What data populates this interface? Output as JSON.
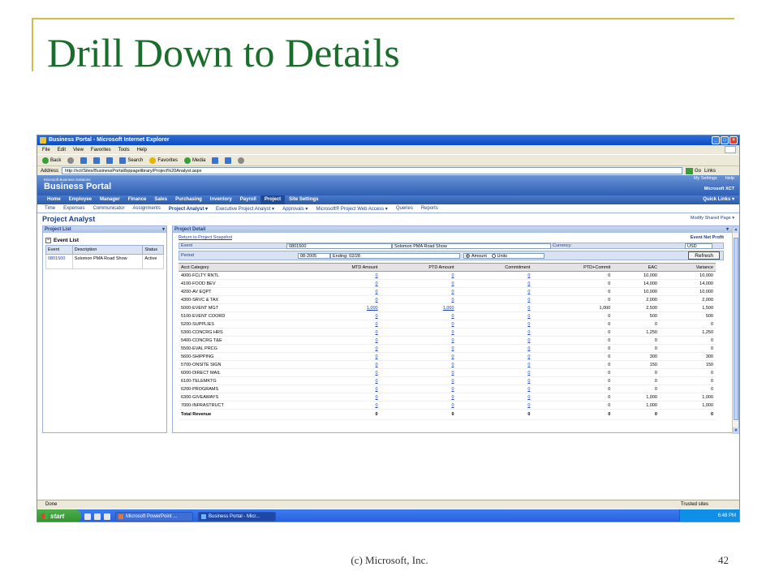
{
  "slide": {
    "title": "Drill Down to Details",
    "footer": "(c) Microsoft, Inc.",
    "page_number": "42"
  },
  "browser": {
    "title": "Business Portal - Microsoft Internet Explorer",
    "menu": [
      "File",
      "Edit",
      "View",
      "Favorites",
      "Tools",
      "Help"
    ],
    "toolbar": {
      "back": "Back",
      "search": "Search",
      "favorites": "Favorites",
      "media": "Media"
    },
    "address_label": "Address",
    "address_url": "http://xct/Sites/BusinessPortal/bppagelibrary/Project%20Analyst.aspx",
    "go": "Go",
    "links": "Links"
  },
  "portal": {
    "brand_sub": "Microsoft Business Solutions",
    "brand": "Business Portal",
    "top_links": [
      "My Settings",
      "Help"
    ],
    "company": "Microsoft XCT",
    "nav": [
      "Home",
      "Employee",
      "Manager",
      "Finance",
      "Sales",
      "Purchasing",
      "Inventory",
      "Payroll",
      "Project",
      "Site Settings"
    ],
    "active_nav": "Project",
    "quick_links": "Quick Links",
    "subnav": [
      {
        "label": "Time",
        "bold": false
      },
      {
        "label": "Expenses",
        "bold": false
      },
      {
        "label": "Communicator",
        "bold": false
      },
      {
        "label": "Assignments",
        "bold": false
      },
      {
        "label": "Project Analyst",
        "bold": true
      },
      {
        "label": "Executive Project Analyst",
        "bold": false
      },
      {
        "label": "Approvals",
        "bold": false
      },
      {
        "label": "Microsoft® Project Web Access",
        "bold": false
      },
      {
        "label": "Queries",
        "bold": false
      },
      {
        "label": "Reports",
        "bold": false
      }
    ],
    "page_title": "Project Analyst",
    "modify_page": "Modify Shared Page"
  },
  "project_list": {
    "header": "Project List",
    "section": "Event List",
    "columns": [
      "Event",
      "Description",
      "Status"
    ],
    "rows": [
      {
        "event": "0801500",
        "description": "Solomon PMA Road Show",
        "status": "Active"
      }
    ]
  },
  "project_detail": {
    "header": "Project Detail",
    "return_link": "Return to Project Snapshot",
    "net_profit": "Event Net Profit",
    "event_label": "Event",
    "event_id": "0801500",
    "event_name": "Solomon PMA Road Show",
    "currency_label": "Currency:",
    "currency": "USD",
    "period_label": "Period",
    "period": "08-2005",
    "ending": "Ending: 02/28",
    "radio_amount": "Amount",
    "radio_units": "Units",
    "refresh": "Refresh",
    "columns": [
      "Acct Category",
      "MTD Amount",
      "PTD Amount",
      "Commitment",
      "PTD+Commit",
      "EAC",
      "Variance"
    ],
    "rows": [
      [
        "4000-FCLTY RNTL",
        "0",
        "0",
        "0",
        "0",
        "10,000",
        "10,000"
      ],
      [
        "4100-FOOD BEV",
        "0",
        "0",
        "0",
        "0",
        "14,000",
        "14,000"
      ],
      [
        "4200-AV EQPT",
        "0",
        "0",
        "0",
        "0",
        "10,000",
        "10,000"
      ],
      [
        "4300-SRVC & TAX",
        "0",
        "0",
        "0",
        "0",
        "2,000",
        "2,000"
      ],
      [
        "5000-EVENT MGT",
        "1,000",
        "1,000",
        "0",
        "1,000",
        "2,500",
        "1,500"
      ],
      [
        "5100-EVENT COORD",
        "0",
        "0",
        "0",
        "0",
        "500",
        "500"
      ],
      [
        "5200-SUPPLIES",
        "0",
        "0",
        "0",
        "0",
        "0",
        "0"
      ],
      [
        "5300-CONCRG HRS",
        "0",
        "0",
        "0",
        "0",
        "1,250",
        "1,250"
      ],
      [
        "5400-CONCRG T&E",
        "0",
        "0",
        "0",
        "0",
        "0",
        "0"
      ],
      [
        "5500-EVAL PRCG",
        "0",
        "0",
        "0",
        "0",
        "0",
        "0"
      ],
      [
        "5600-SHIPPING",
        "0",
        "0",
        "0",
        "0",
        "300",
        "300"
      ],
      [
        "5700-ONSITE SIGN",
        "0",
        "0",
        "0",
        "0",
        "150",
        "150"
      ],
      [
        "6000-DIRECT MAIL",
        "0",
        "0",
        "0",
        "0",
        "0",
        "0"
      ],
      [
        "6100-TELEMKTG",
        "0",
        "0",
        "0",
        "0",
        "0",
        "0"
      ],
      [
        "6200-PROGRAMS",
        "0",
        "0",
        "0",
        "0",
        "0",
        "0"
      ],
      [
        "6300-GIVEAWAYS",
        "0",
        "0",
        "0",
        "0",
        "1,000",
        "1,000"
      ],
      [
        "7000-INFRASTRUCT",
        "0",
        "0",
        "0",
        "0",
        "1,000",
        "1,000"
      ]
    ],
    "total_row": [
      "Total Revenue",
      "0",
      "0",
      "0",
      "0",
      "0",
      "0"
    ]
  },
  "status": {
    "left": "Done",
    "zone": "Trusted sites"
  },
  "taskbar": {
    "start": "start",
    "tasks": [
      "Microsoft PowerPoint ...",
      "Business Portal - Micr..."
    ],
    "clock": "6:48 PM"
  },
  "colors": {
    "title_green": "#1a6e2b",
    "accent_gold": "#d6b94c",
    "portal_blue": "#2e5fb4"
  }
}
